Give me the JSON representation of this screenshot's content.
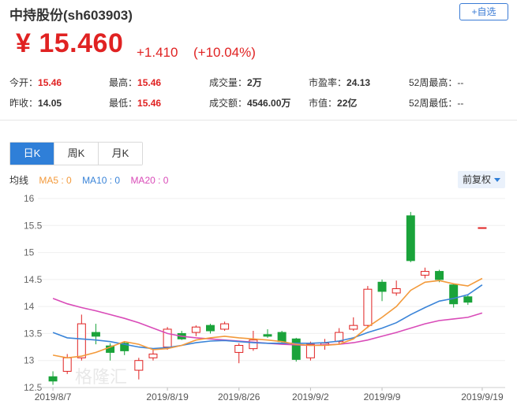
{
  "header": {
    "title": "中持股份(sh603903)",
    "add_button": "+自选",
    "price": "¥ 15.460",
    "change": "+1.410",
    "change_pct": "(+10.04%)"
  },
  "stats": [
    {
      "label": "今开：",
      "value": "15.46",
      "color": "red"
    },
    {
      "label": "最高：",
      "value": "15.46",
      "color": "red"
    },
    {
      "label": "成交量：",
      "value": "2万",
      "color": "black"
    },
    {
      "label": "市盈率：",
      "value": "24.13",
      "color": "black"
    },
    {
      "label": "52周最高：",
      "value": "--",
      "color": "gray"
    },
    {
      "label": "昨收：",
      "value": "14.05",
      "color": "black"
    },
    {
      "label": "最低：",
      "value": "15.46",
      "color": "red"
    },
    {
      "label": "成交额：",
      "value": "4546.00万",
      "color": "black"
    },
    {
      "label": "市值：",
      "value": "22亿",
      "color": "black"
    },
    {
      "label": "52周最低：",
      "value": "--",
      "color": "gray"
    }
  ],
  "tabs": [
    "日K",
    "周K",
    "月K"
  ],
  "active_tab": 0,
  "ma_labels": {
    "title": "均线",
    "ma5": "MA5 : 0",
    "ma10": "MA10 : 0",
    "ma20": "MA20 : 0"
  },
  "adjust_button": "前复权",
  "watermark": "格隆汇",
  "colors": {
    "up": "#e02222",
    "down": "#1aa33a",
    "ma5": "#f39a3b",
    "ma10": "#3a84d8",
    "ma20": "#d94bb8"
  },
  "chart_data": {
    "type": "candlestick",
    "ylim": [
      12.5,
      16.0
    ],
    "yticks": [
      12.5,
      13,
      13.5,
      14,
      14.5,
      15,
      15.5,
      16
    ],
    "ytick_labels": [
      "12.5",
      "13",
      "13.5",
      "14",
      "14.5",
      "15",
      "15.5",
      "16"
    ],
    "xtick_labels": [
      {
        "index": 0,
        "label": "2019/8/7"
      },
      {
        "index": 8,
        "label": "2019/8/19"
      },
      {
        "index": 13,
        "label": "2019/8/26"
      },
      {
        "index": 18,
        "label": "2019/9/2"
      },
      {
        "index": 23,
        "label": "2019/9/9"
      },
      {
        "index": 30,
        "label": "2019/9/19"
      }
    ],
    "candles": [
      {
        "open": 12.7,
        "close": 12.62,
        "high": 12.8,
        "low": 12.55
      },
      {
        "open": 12.8,
        "close": 13.05,
        "high": 13.12,
        "low": 12.75
      },
      {
        "open": 13.05,
        "close": 13.68,
        "high": 13.85,
        "low": 13.0
      },
      {
        "open": 13.52,
        "close": 13.45,
        "high": 13.68,
        "low": 13.3
      },
      {
        "open": 13.27,
        "close": 13.15,
        "high": 13.32,
        "low": 13.0
      },
      {
        "open": 13.32,
        "close": 13.18,
        "high": 13.35,
        "low": 13.1
      },
      {
        "open": 12.82,
        "close": 13.0,
        "high": 13.05,
        "low": 12.65
      },
      {
        "open": 13.05,
        "close": 13.12,
        "high": 13.2,
        "low": 13.0
      },
      {
        "open": 13.25,
        "close": 13.58,
        "high": 13.62,
        "low": 13.2
      },
      {
        "open": 13.5,
        "close": 13.4,
        "high": 13.55,
        "low": 13.38
      },
      {
        "open": 13.52,
        "close": 13.62,
        "high": 13.65,
        "low": 13.45
      },
      {
        "open": 13.65,
        "close": 13.55,
        "high": 13.68,
        "low": 13.5
      },
      {
        "open": 13.58,
        "close": 13.68,
        "high": 13.72,
        "low": 13.55
      },
      {
        "open": 13.15,
        "close": 13.28,
        "high": 13.32,
        "low": 12.95
      },
      {
        "open": 13.22,
        "close": 13.38,
        "high": 13.55,
        "low": 13.18
      },
      {
        "open": 13.48,
        "close": 13.45,
        "high": 13.58,
        "low": 13.42
      },
      {
        "open": 13.52,
        "close": 13.35,
        "high": 13.55,
        "low": 13.3
      },
      {
        "open": 13.4,
        "close": 13.02,
        "high": 13.42,
        "low": 12.98
      },
      {
        "open": 13.05,
        "close": 13.3,
        "high": 13.35,
        "low": 13.0
      },
      {
        "open": 13.28,
        "close": 13.32,
        "high": 13.4,
        "low": 13.2
      },
      {
        "open": 13.35,
        "close": 13.52,
        "high": 13.6,
        "low": 13.3
      },
      {
        "open": 13.58,
        "close": 13.65,
        "high": 13.8,
        "low": 13.55
      },
      {
        "open": 13.65,
        "close": 14.32,
        "high": 14.38,
        "low": 13.6
      },
      {
        "open": 14.45,
        "close": 14.28,
        "high": 14.5,
        "low": 14.1
      },
      {
        "open": 14.25,
        "close": 14.33,
        "high": 14.48,
        "low": 14.2
      },
      {
        "open": 15.68,
        "close": 14.85,
        "high": 15.75,
        "low": 14.82
      },
      {
        "open": 14.58,
        "close": 14.65,
        "high": 14.72,
        "low": 14.52
      },
      {
        "open": 14.65,
        "close": 14.5,
        "high": 14.68,
        "low": 14.45
      },
      {
        "open": 14.4,
        "close": 14.05,
        "high": 14.42,
        "low": 13.98
      },
      {
        "open": 14.18,
        "close": 14.08,
        "high": 14.22,
        "low": 14.03
      },
      {
        "open": 15.46,
        "close": 15.46,
        "high": 15.46,
        "low": 15.46
      }
    ],
    "ma5": [
      13.1,
      13.05,
      13.08,
      13.15,
      13.25,
      13.35,
      13.3,
      13.2,
      13.22,
      13.28,
      13.38,
      13.42,
      13.45,
      13.42,
      13.4,
      13.38,
      13.35,
      13.3,
      13.28,
      13.28,
      13.3,
      13.4,
      13.62,
      13.8,
      14.0,
      14.3,
      14.45,
      14.48,
      14.42,
      14.38,
      14.52
    ],
    "ma10": [
      13.52,
      13.42,
      13.4,
      13.38,
      13.35,
      13.3,
      13.25,
      13.22,
      13.24,
      13.28,
      13.33,
      13.36,
      13.37,
      13.35,
      13.33,
      13.32,
      13.32,
      13.32,
      13.32,
      13.33,
      13.36,
      13.42,
      13.52,
      13.6,
      13.7,
      13.85,
      13.98,
      14.1,
      14.15,
      14.22,
      14.4
    ],
    "ma20": [
      14.15,
      14.05,
      13.98,
      13.92,
      13.85,
      13.78,
      13.7,
      13.6,
      13.5,
      13.45,
      13.42,
      13.4,
      13.38,
      13.36,
      13.34,
      13.32,
      13.3,
      13.29,
      13.28,
      13.29,
      13.3,
      13.33,
      13.38,
      13.45,
      13.52,
      13.6,
      13.68,
      13.74,
      13.77,
      13.8,
      13.88
    ]
  }
}
